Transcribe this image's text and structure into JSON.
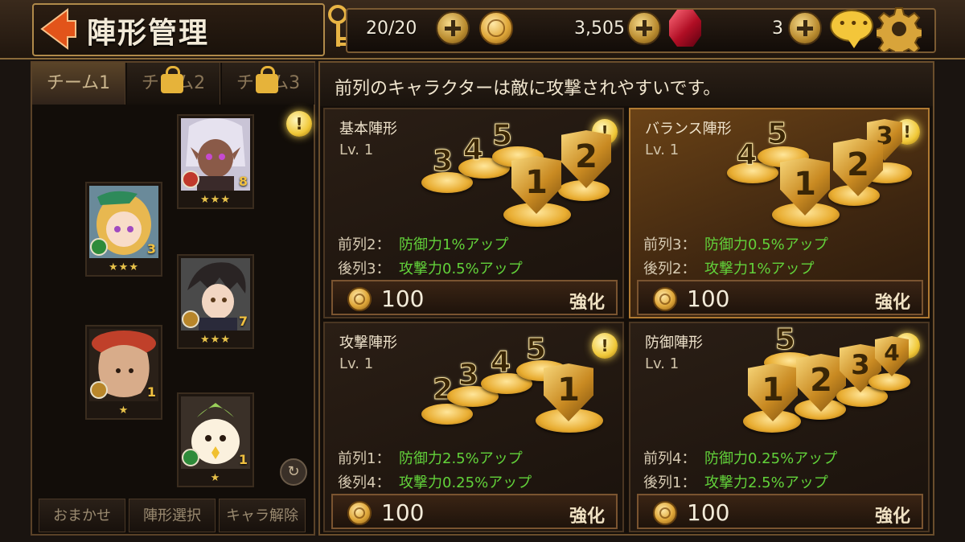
{
  "header": {
    "title": "陣形管理",
    "stamina": "20/20",
    "gold": "3,505",
    "gems": "3"
  },
  "teams": {
    "tabs": [
      {
        "label": "チーム1",
        "locked": false
      },
      {
        "label": "チーム2",
        "locked": true
      },
      {
        "label": "チーム3",
        "locked": true
      }
    ],
    "characters": [
      {
        "level": "8",
        "stars": "★★★",
        "class_color": "#c0392b"
      },
      {
        "level": "3",
        "stars": "★★★",
        "class_color": "#2e8b3a"
      },
      {
        "level": "7",
        "stars": "★★★",
        "class_color": "#b8862a"
      },
      {
        "level": "1",
        "stars": "★",
        "class_color": "#b8862a"
      },
      {
        "level": "1",
        "stars": "★",
        "class_color": "#2e8b3a"
      }
    ],
    "buttons": {
      "auto": "おまかせ",
      "select": "陣形選択",
      "release": "キャラ解除"
    }
  },
  "info": "前列のキャラクターは敵に攻撃されやすいです。",
  "formations": [
    {
      "name": "基本陣形",
      "level": "Lv.  1",
      "bonus1_label": "前列2：",
      "bonus1_value": "防御力1%アップ",
      "bonus2_label": "後列3：",
      "bonus2_value": "攻撃力0.5%アップ",
      "cost": "100",
      "upgrade": "強化",
      "selected": false
    },
    {
      "name": "バランス陣形",
      "level": "Lv.  1",
      "bonus1_label": "前列3：",
      "bonus1_value": "防御力0.5%アップ",
      "bonus2_label": "後列2：",
      "bonus2_value": "攻撃力1%アップ",
      "cost": "100",
      "upgrade": "強化",
      "selected": true
    },
    {
      "name": "攻撃陣形",
      "level": "Lv.  1",
      "bonus1_label": "前列1：",
      "bonus1_value": "防御力2.5%アップ",
      "bonus2_label": "後列4：",
      "bonus2_value": "攻撃力0.25%アップ",
      "cost": "100",
      "upgrade": "強化",
      "selected": false
    },
    {
      "name": "防御陣形",
      "level": "Lv.  1",
      "bonus1_label": "前列4：",
      "bonus1_value": "防御力0.25%アップ",
      "bonus2_label": "後列1：",
      "bonus2_value": "攻撃力2.5%アップ",
      "cost": "100",
      "upgrade": "強化",
      "selected": false
    }
  ],
  "slot_labels": [
    "1",
    "2",
    "3",
    "4",
    "5"
  ],
  "icons": {
    "back": "back-arrow-icon",
    "key": "key-icon",
    "coin": "coin-icon",
    "gem": "ruby-gem-icon",
    "chat": "chat-icon",
    "gear": "gear-icon",
    "lock": "lock-icon",
    "hint": "hint-icon",
    "rotate": "rotate-icon"
  },
  "colors": {
    "accent": "#e0a83a",
    "bonus": "#62d23a",
    "selected": "#6a4216"
  }
}
